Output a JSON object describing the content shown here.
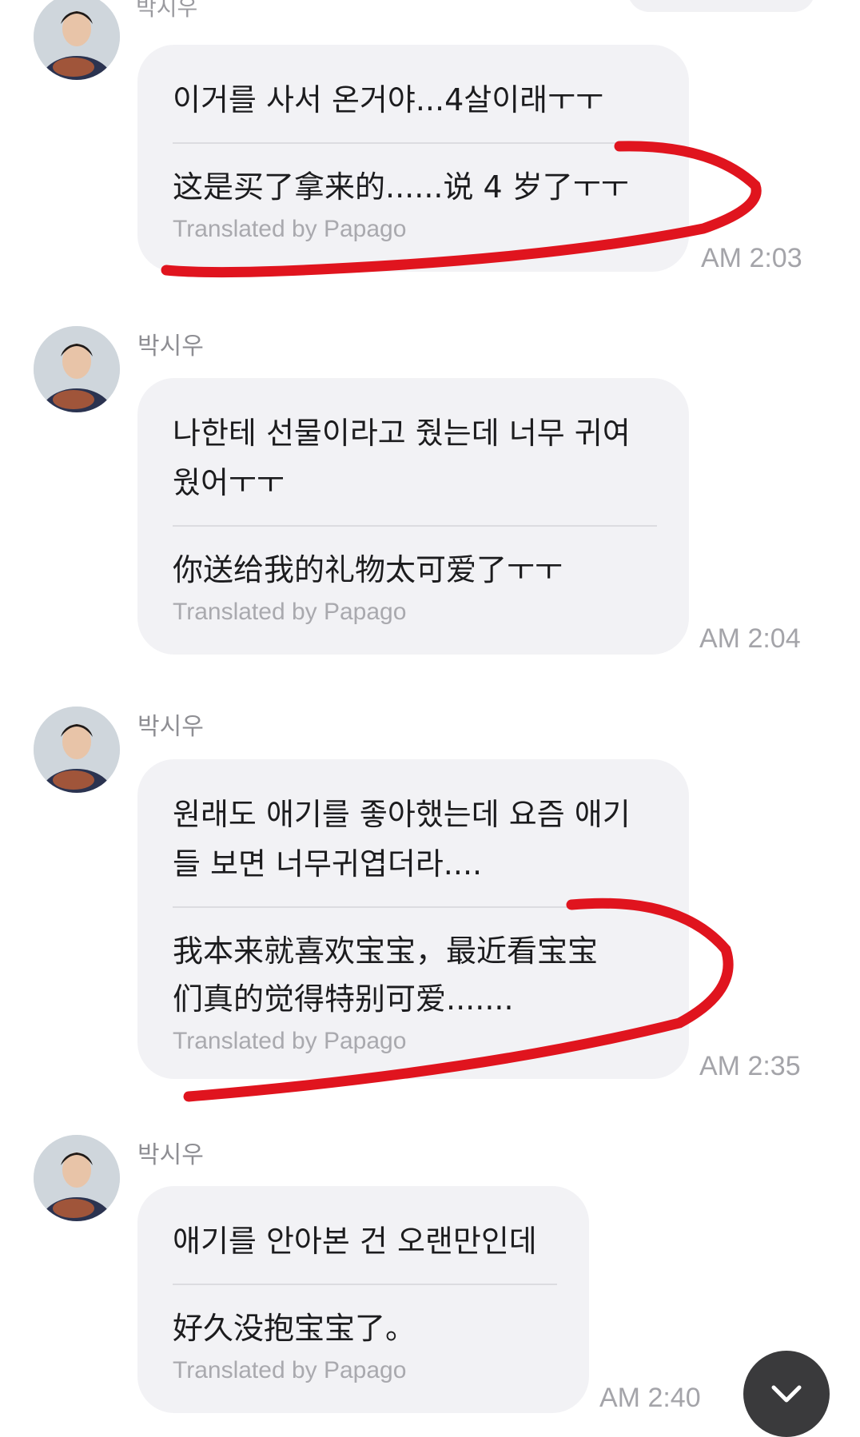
{
  "top_partial": {
    "sender": "박시우"
  },
  "messages": [
    {
      "sender": "박시우",
      "original": "이거를 사서 온거야...4살이래ㅜㅜ",
      "translation": "这是买了拿来的......说 4 岁了ㅜㅜ",
      "translated_by": "Translated by Papago",
      "time": "AM 2:03"
    },
    {
      "sender": "박시우",
      "original": "나한테 선물이라고 줬는데 너무 귀여\n웠어ㅜㅜ",
      "translation": "你送给我的礼物太可爱了ㅜㅜ",
      "translated_by": "Translated by Papago",
      "time": "AM 2:04"
    },
    {
      "sender": "박시우",
      "original": "원래도 애기를 좋아했는데 요즘 애기\n들 보면 너무귀엽더라....",
      "translation": "我本来就喜欢宝宝，最近看宝宝\n们真的觉得特别可爱.......",
      "translated_by": "Translated by Papago",
      "time": "AM 2:35"
    },
    {
      "sender": "박시우",
      "original": "애기를 안아본 건 오랜만인데",
      "translation": "好久没抱宝宝了。",
      "translated_by": "Translated by Papago",
      "time": "AM 2:40"
    }
  ],
  "scroll_button": {
    "icon": "chevron-down-icon"
  },
  "annotation_color": "#e0141e"
}
